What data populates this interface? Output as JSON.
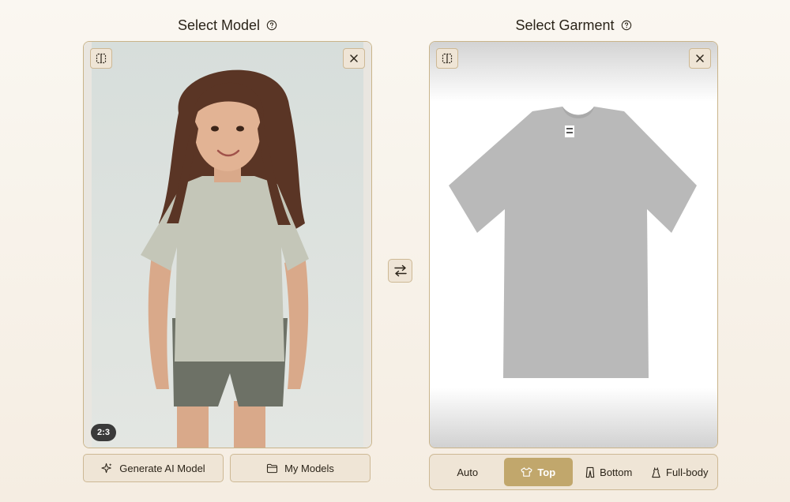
{
  "model_section": {
    "title": "Select Model",
    "aspect_ratio_badge": "2:3",
    "generate_button_label": "Generate AI Model",
    "my_models_button_label": "My Models"
  },
  "garment_section": {
    "title": "Select Garment",
    "category_options": [
      {
        "label": "Auto",
        "icon": "none",
        "selected": false
      },
      {
        "label": "Top",
        "icon": "tshirt-icon",
        "selected": true
      },
      {
        "label": "Bottom",
        "icon": "pants-icon",
        "selected": false
      },
      {
        "label": "Full-body",
        "icon": "dress-icon",
        "selected": false
      }
    ]
  },
  "colors": {
    "accent": "#c1a76c",
    "panel_border": "#c9b48a",
    "button_bg": "#efe5d6"
  }
}
